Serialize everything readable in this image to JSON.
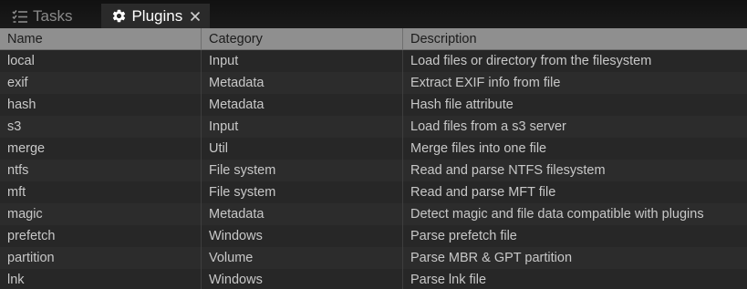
{
  "tabs": [
    {
      "label": "Tasks",
      "icon": "checklist-icon",
      "active": false
    },
    {
      "label": "Plugins",
      "icon": "gear-icon",
      "active": true,
      "closable": true
    }
  ],
  "table": {
    "columns": [
      "Name",
      "Category",
      "Description"
    ],
    "rows": [
      [
        "local",
        "Input",
        "Load files or directory from the filesystem"
      ],
      [
        "exif",
        "Metadata",
        "Extract EXIF info from file"
      ],
      [
        "hash",
        "Metadata",
        "Hash file attribute"
      ],
      [
        "s3",
        "Input",
        "Load files from a s3 server"
      ],
      [
        "merge",
        "Util",
        "Merge files into one file"
      ],
      [
        "ntfs",
        "File system",
        "Read and parse NTFS filesystem"
      ],
      [
        "mft",
        "File system",
        "Read and parse MFT file"
      ],
      [
        "magic",
        "Metadata",
        "Detect magic and file data compatible with plugins"
      ],
      [
        "prefetch",
        "Windows",
        "Parse prefetch file"
      ],
      [
        "partition",
        "Volume",
        "Parse MBR & GPT partition"
      ],
      [
        "lnk",
        "Windows",
        "Parse lnk file"
      ]
    ]
  },
  "colors": {
    "background": "#262626",
    "header_bg": "#8f8f8f",
    "text": "#c8c8c8",
    "active_tab_text": "#ffffff",
    "inactive_tab_text": "#8a8a8a"
  }
}
